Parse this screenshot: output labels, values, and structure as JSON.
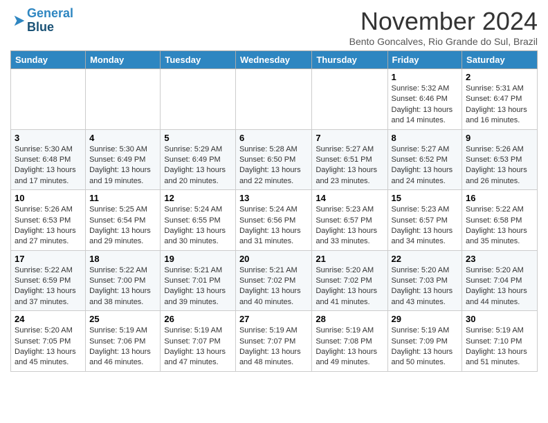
{
  "header": {
    "logo_line1": "General",
    "logo_line2": "Blue",
    "title": "November 2024",
    "subtitle": "Bento Goncalves, Rio Grande do Sul, Brazil"
  },
  "calendar": {
    "days_of_week": [
      "Sunday",
      "Monday",
      "Tuesday",
      "Wednesday",
      "Thursday",
      "Friday",
      "Saturday"
    ],
    "weeks": [
      [
        {
          "day": "",
          "info": ""
        },
        {
          "day": "",
          "info": ""
        },
        {
          "day": "",
          "info": ""
        },
        {
          "day": "",
          "info": ""
        },
        {
          "day": "",
          "info": ""
        },
        {
          "day": "1",
          "info": "Sunrise: 5:32 AM\nSunset: 6:46 PM\nDaylight: 13 hours and 14 minutes."
        },
        {
          "day": "2",
          "info": "Sunrise: 5:31 AM\nSunset: 6:47 PM\nDaylight: 13 hours and 16 minutes."
        }
      ],
      [
        {
          "day": "3",
          "info": "Sunrise: 5:30 AM\nSunset: 6:48 PM\nDaylight: 13 hours and 17 minutes."
        },
        {
          "day": "4",
          "info": "Sunrise: 5:30 AM\nSunset: 6:49 PM\nDaylight: 13 hours and 19 minutes."
        },
        {
          "day": "5",
          "info": "Sunrise: 5:29 AM\nSunset: 6:49 PM\nDaylight: 13 hours and 20 minutes."
        },
        {
          "day": "6",
          "info": "Sunrise: 5:28 AM\nSunset: 6:50 PM\nDaylight: 13 hours and 22 minutes."
        },
        {
          "day": "7",
          "info": "Sunrise: 5:27 AM\nSunset: 6:51 PM\nDaylight: 13 hours and 23 minutes."
        },
        {
          "day": "8",
          "info": "Sunrise: 5:27 AM\nSunset: 6:52 PM\nDaylight: 13 hours and 24 minutes."
        },
        {
          "day": "9",
          "info": "Sunrise: 5:26 AM\nSunset: 6:53 PM\nDaylight: 13 hours and 26 minutes."
        }
      ],
      [
        {
          "day": "10",
          "info": "Sunrise: 5:26 AM\nSunset: 6:53 PM\nDaylight: 13 hours and 27 minutes."
        },
        {
          "day": "11",
          "info": "Sunrise: 5:25 AM\nSunset: 6:54 PM\nDaylight: 13 hours and 29 minutes."
        },
        {
          "day": "12",
          "info": "Sunrise: 5:24 AM\nSunset: 6:55 PM\nDaylight: 13 hours and 30 minutes."
        },
        {
          "day": "13",
          "info": "Sunrise: 5:24 AM\nSunset: 6:56 PM\nDaylight: 13 hours and 31 minutes."
        },
        {
          "day": "14",
          "info": "Sunrise: 5:23 AM\nSunset: 6:57 PM\nDaylight: 13 hours and 33 minutes."
        },
        {
          "day": "15",
          "info": "Sunrise: 5:23 AM\nSunset: 6:57 PM\nDaylight: 13 hours and 34 minutes."
        },
        {
          "day": "16",
          "info": "Sunrise: 5:22 AM\nSunset: 6:58 PM\nDaylight: 13 hours and 35 minutes."
        }
      ],
      [
        {
          "day": "17",
          "info": "Sunrise: 5:22 AM\nSunset: 6:59 PM\nDaylight: 13 hours and 37 minutes."
        },
        {
          "day": "18",
          "info": "Sunrise: 5:22 AM\nSunset: 7:00 PM\nDaylight: 13 hours and 38 minutes."
        },
        {
          "day": "19",
          "info": "Sunrise: 5:21 AM\nSunset: 7:01 PM\nDaylight: 13 hours and 39 minutes."
        },
        {
          "day": "20",
          "info": "Sunrise: 5:21 AM\nSunset: 7:02 PM\nDaylight: 13 hours and 40 minutes."
        },
        {
          "day": "21",
          "info": "Sunrise: 5:20 AM\nSunset: 7:02 PM\nDaylight: 13 hours and 41 minutes."
        },
        {
          "day": "22",
          "info": "Sunrise: 5:20 AM\nSunset: 7:03 PM\nDaylight: 13 hours and 43 minutes."
        },
        {
          "day": "23",
          "info": "Sunrise: 5:20 AM\nSunset: 7:04 PM\nDaylight: 13 hours and 44 minutes."
        }
      ],
      [
        {
          "day": "24",
          "info": "Sunrise: 5:20 AM\nSunset: 7:05 PM\nDaylight: 13 hours and 45 minutes."
        },
        {
          "day": "25",
          "info": "Sunrise: 5:19 AM\nSunset: 7:06 PM\nDaylight: 13 hours and 46 minutes."
        },
        {
          "day": "26",
          "info": "Sunrise: 5:19 AM\nSunset: 7:07 PM\nDaylight: 13 hours and 47 minutes."
        },
        {
          "day": "27",
          "info": "Sunrise: 5:19 AM\nSunset: 7:07 PM\nDaylight: 13 hours and 48 minutes."
        },
        {
          "day": "28",
          "info": "Sunrise: 5:19 AM\nSunset: 7:08 PM\nDaylight: 13 hours and 49 minutes."
        },
        {
          "day": "29",
          "info": "Sunrise: 5:19 AM\nSunset: 7:09 PM\nDaylight: 13 hours and 50 minutes."
        },
        {
          "day": "30",
          "info": "Sunrise: 5:19 AM\nSunset: 7:10 PM\nDaylight: 13 hours and 51 minutes."
        }
      ]
    ]
  }
}
